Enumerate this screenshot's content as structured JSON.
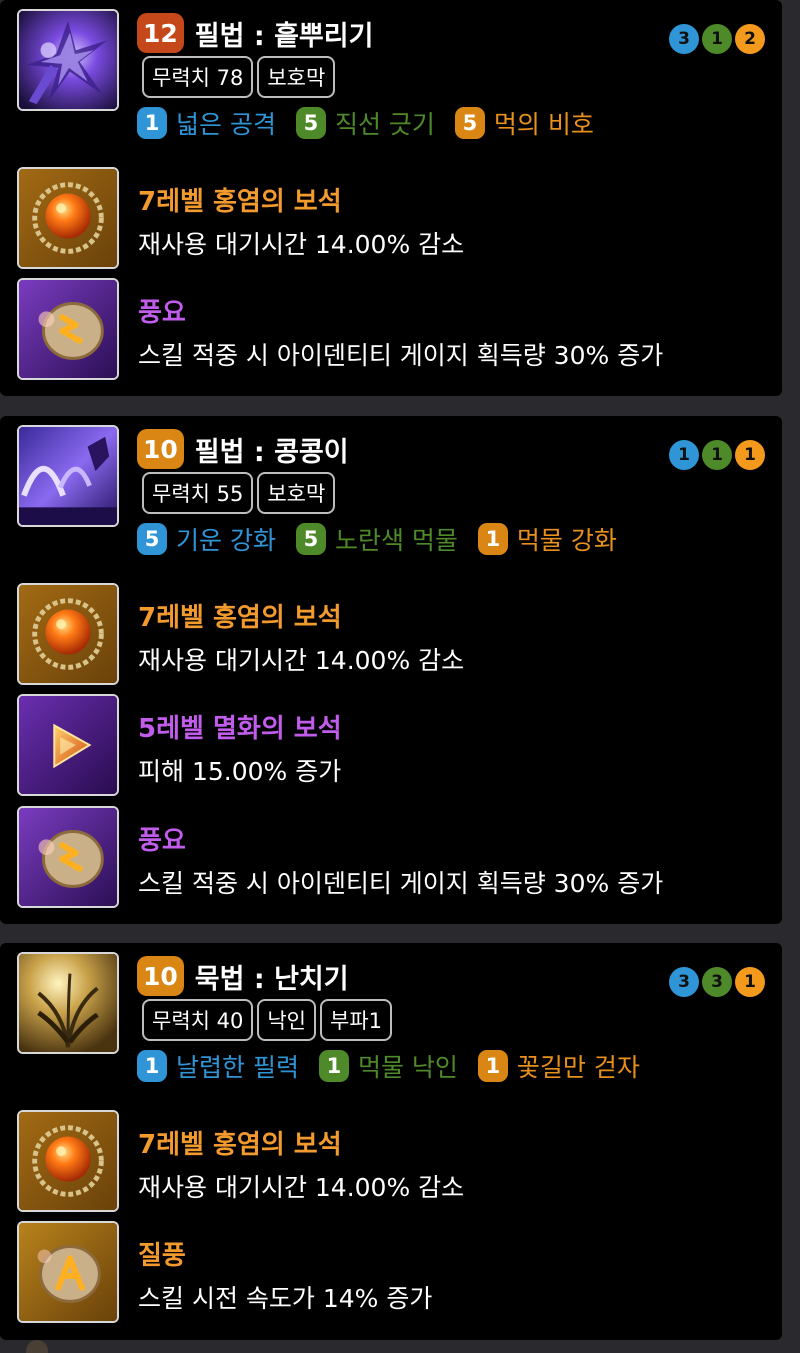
{
  "colors": {
    "blue": "#2f95d6",
    "green": "#4f8a2a",
    "orange": "#e8901c",
    "gem_red_name": "#f29a2e",
    "gem_purple_name": "#c25cec",
    "rune_name": "#c25cec",
    "badge_red": "#c5481a",
    "badge_orange": "#d98614"
  },
  "skills": [
    {
      "level": "12",
      "name": "필법 : 흩뿌리기",
      "tags": [
        "무력치 78",
        "보호막"
      ],
      "tiers": [
        "3",
        "1",
        "2"
      ],
      "tripods": [
        {
          "num": "1",
          "name": "넓은 공격"
        },
        {
          "num": "5",
          "name": "직선 긋기"
        },
        {
          "num": "5",
          "name": "먹의 비호"
        }
      ],
      "equips": [
        {
          "icon": "gem-red-icon",
          "name": "7레벨 홍염의 보석",
          "desc": "재사용 대기시간 14.00% 감소"
        },
        {
          "icon": "rune-icon",
          "name": "풍요",
          "desc": "스킬 적중 시 아이덴티티 게이지 획득량 30% 증가"
        }
      ]
    },
    {
      "level": "10",
      "name": "필법 : 콩콩이",
      "tags": [
        "무력치 55",
        "보호막"
      ],
      "tiers": [
        "1",
        "1",
        "1"
      ],
      "tripods": [
        {
          "num": "5",
          "name": "기운 강화"
        },
        {
          "num": "5",
          "name": "노란색 먹물"
        },
        {
          "num": "1",
          "name": "먹물 강화"
        }
      ],
      "equips": [
        {
          "icon": "gem-red-icon",
          "name": "7레벨 홍염의 보석",
          "desc": "재사용 대기시간 14.00% 감소"
        },
        {
          "icon": "gem-purple-icon",
          "name": "5레벨 멸화의 보석",
          "desc": "피해 15.00% 증가"
        },
        {
          "icon": "rune-icon",
          "name": "풍요",
          "desc": "스킬 적중 시 아이덴티티 게이지 획득량 30% 증가"
        }
      ]
    },
    {
      "level": "10",
      "name": "묵법 : 난치기",
      "tags": [
        "무력치 40",
        "낙인",
        "부파1"
      ],
      "tiers": [
        "3",
        "3",
        "1"
      ],
      "tripods": [
        {
          "num": "1",
          "name": "날렵한 필력"
        },
        {
          "num": "1",
          "name": "먹물 낙인"
        },
        {
          "num": "1",
          "name": "꽃길만 걷자"
        }
      ],
      "equips": [
        {
          "icon": "gem-red-icon",
          "name": "7레벨 홍염의 보석",
          "desc": "재사용 대기시간 14.00% 감소"
        },
        {
          "icon": "rune-icon",
          "name": "질풍",
          "desc": "스킬 시전 속도가 14% 증가"
        }
      ]
    }
  ]
}
